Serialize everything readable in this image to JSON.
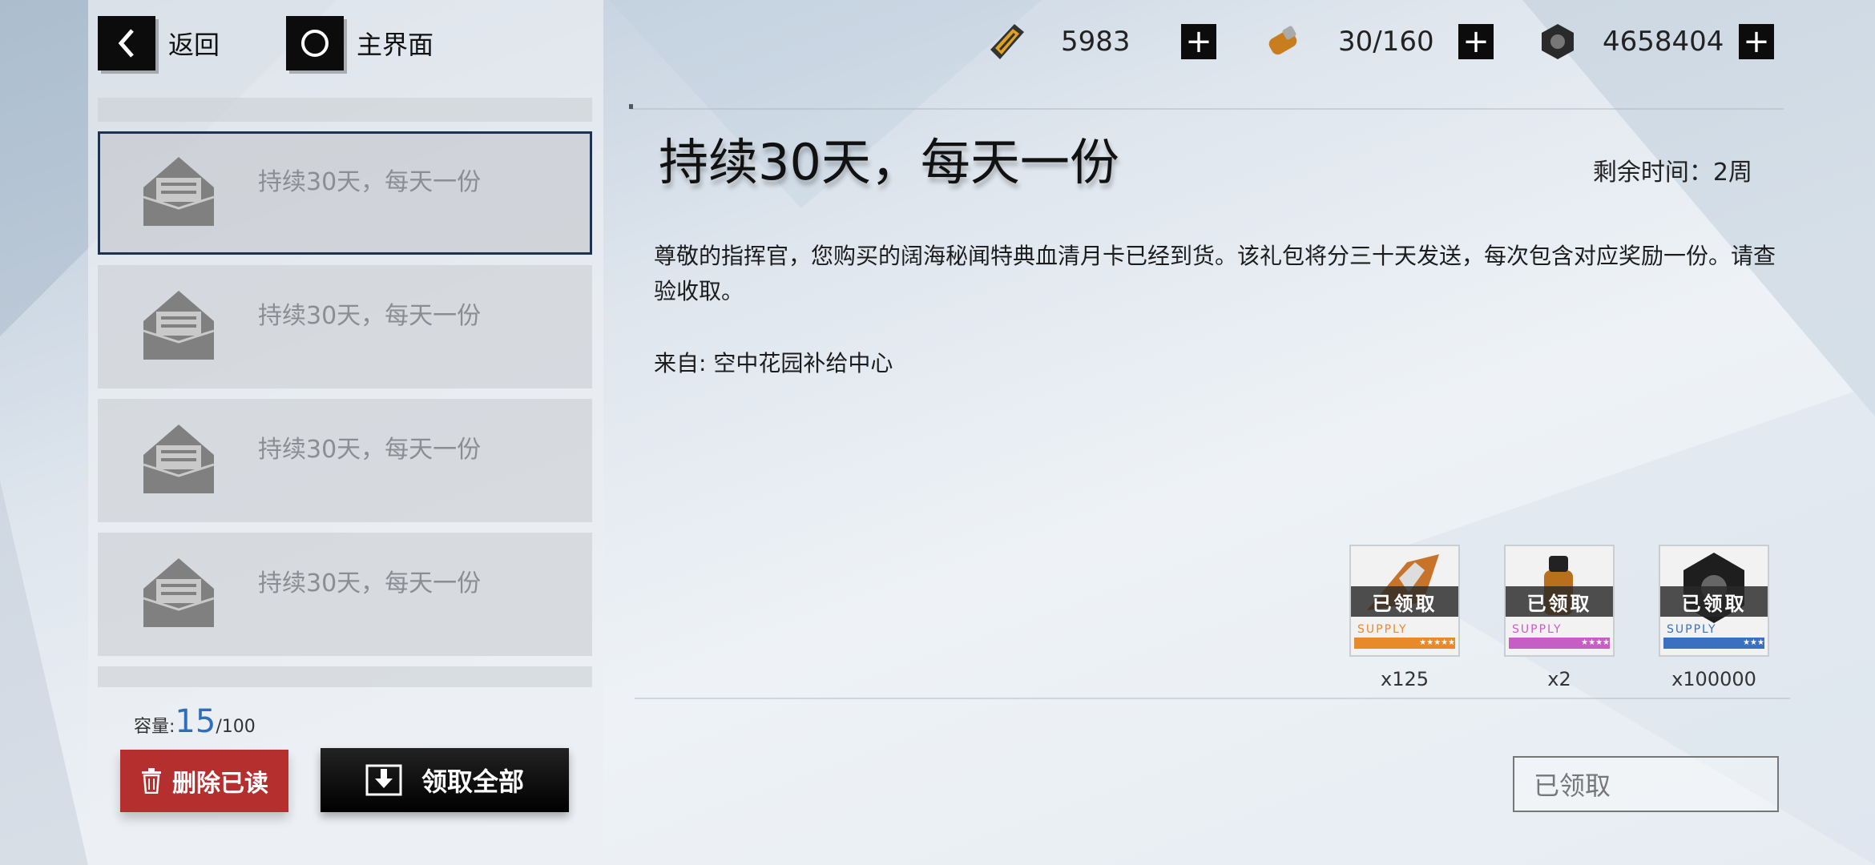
{
  "topbar": {
    "back_label": "返回",
    "home_label": "主界面"
  },
  "resources": [
    {
      "icon": "ammo-card-icon",
      "value": "5983"
    },
    {
      "icon": "fuel-canister-icon",
      "value": "30/160"
    },
    {
      "icon": "hex-nut-icon",
      "value": "4658404"
    }
  ],
  "mail_list": {
    "items": [
      {
        "subject": "持续30天，每天一份",
        "selected": true
      },
      {
        "subject": "持续30天，每天一份",
        "selected": false
      },
      {
        "subject": "持续30天，每天一份",
        "selected": false
      },
      {
        "subject": "持续30天，每天一份",
        "selected": false
      }
    ],
    "capacity_label": "容量:",
    "capacity_used": "15",
    "capacity_total": "/100"
  },
  "actions": {
    "delete_read": "删除已读",
    "claim_all": "领取全部"
  },
  "mail": {
    "title": "持续30天，每天一份",
    "remaining": "剩余时间：2周",
    "body": "尊敬的指挥官，您购买的阔海秘闻特典血清月卡已经到货。该礼包将分三十天发送，每次包含对应奖励一份。请查验收取。",
    "from": "来自: 空中花园补给中心",
    "rewards": [
      {
        "icon": "ammo-card-icon",
        "status": "已领取",
        "supply": "SUPPLY",
        "color": "#e8892a",
        "stars": "★★★★★",
        "qty": "x125"
      },
      {
        "icon": "fuel-canister-icon",
        "status": "已领取",
        "supply": "SUPPLY",
        "color": "#c75ec4",
        "stars": "★★★★",
        "qty": "x2"
      },
      {
        "icon": "hex-nut-icon",
        "status": "已领取",
        "supply": "SUPPLY",
        "color": "#3b6fc0",
        "stars": "★★★",
        "qty": "x100000"
      }
    ],
    "claimed_button": "已领取"
  }
}
